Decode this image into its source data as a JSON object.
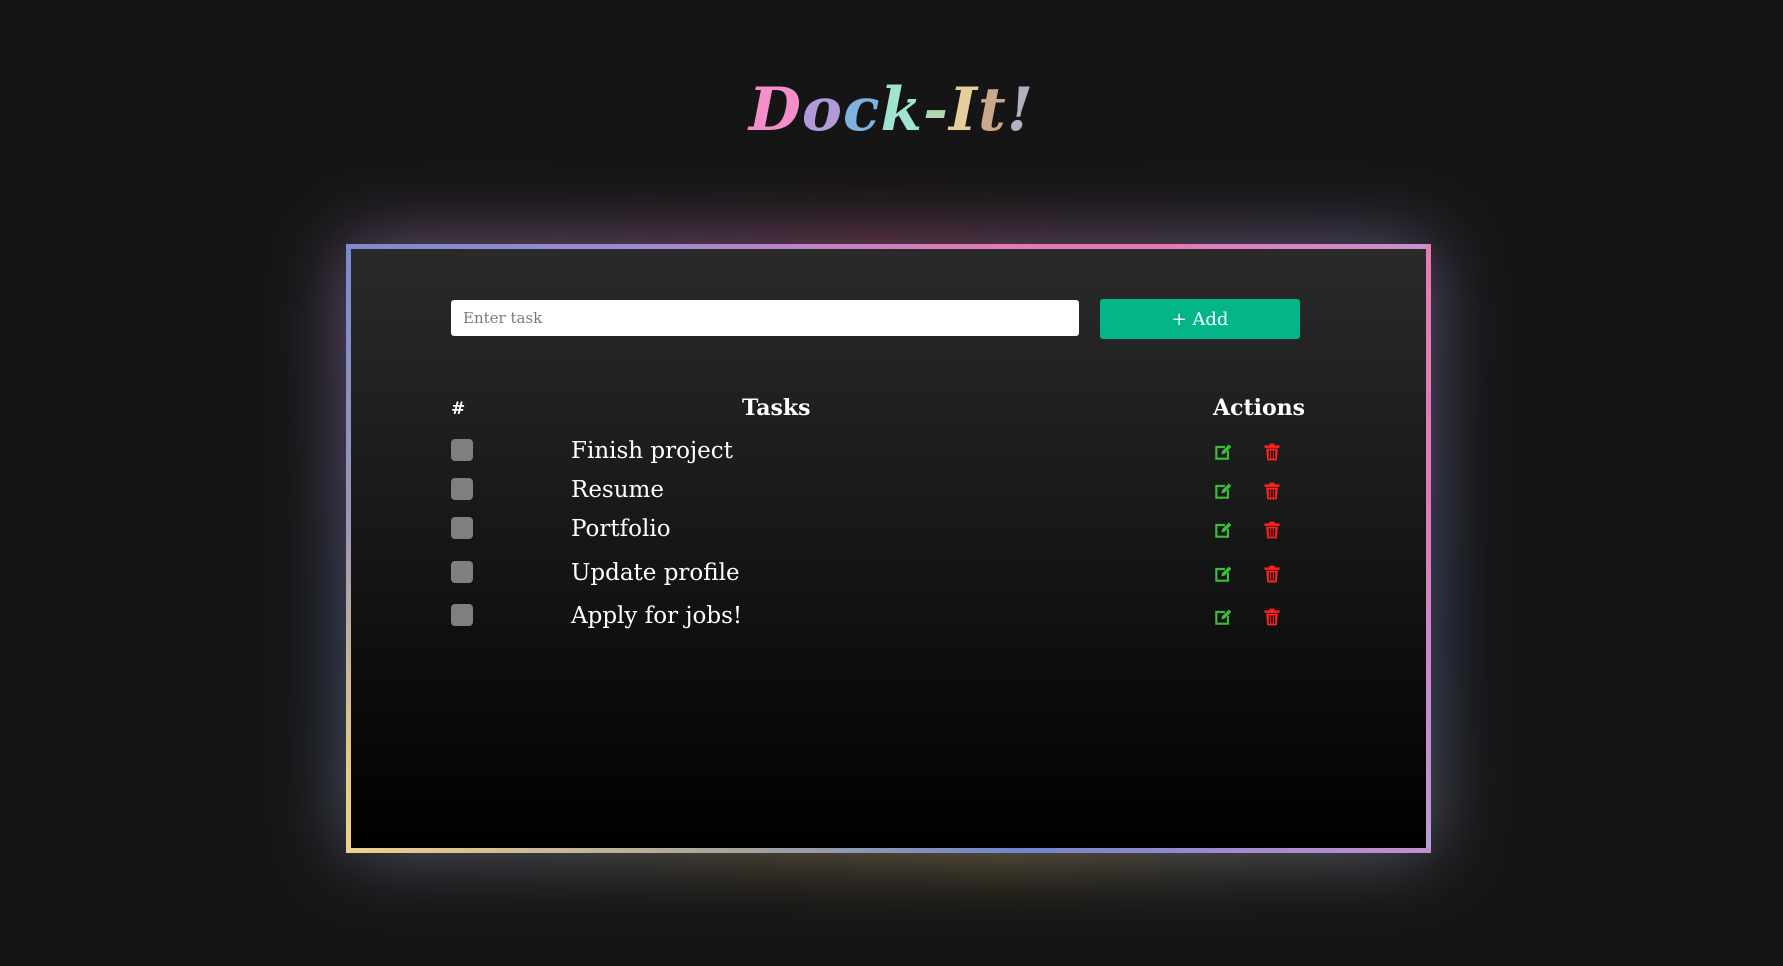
{
  "app": {
    "title_parts": [
      "D",
      "o",
      "c",
      "k",
      "-",
      "I",
      "t",
      "!"
    ],
    "title_colors": [
      "#f38ec9",
      "#b29ad8",
      "#80b2e0",
      "#9fe3d0",
      "#b2d6b4",
      "#e5ce9c",
      "#c9a98a",
      "#b4b0c2"
    ]
  },
  "form": {
    "placeholder": "Enter task",
    "add_label": "+ Add"
  },
  "table": {
    "headers": {
      "num": "#",
      "tasks": "Tasks",
      "actions": "Actions"
    },
    "rows": [
      {
        "text": "Finish project",
        "checked": false
      },
      {
        "text": "Resume",
        "checked": false
      },
      {
        "text": "Portfolio",
        "checked": false
      },
      {
        "text": "Update profile",
        "checked": false
      },
      {
        "text": "Apply for jobs!",
        "checked": false
      }
    ]
  },
  "icons": {
    "edit": "edit-icon",
    "delete": "trash-icon"
  },
  "colors": {
    "accent": "#03b589",
    "edit_icon": "#3bbd3b",
    "delete_icon": "#ff2222",
    "checkbox": "#7f7f7f"
  }
}
